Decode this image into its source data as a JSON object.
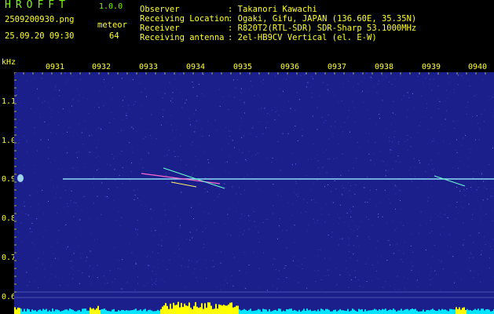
{
  "app": {
    "name": "HROFFT",
    "version": "1.0.0"
  },
  "file": {
    "name": "2509200930.png",
    "datetime": "25.09.20 09:30"
  },
  "detection": {
    "label": "meteor",
    "count": "64"
  },
  "info": {
    "observer_label": "Observer",
    "observer_value": ": Takanori Kawachi",
    "location_label": "Receiving Location",
    "location_value": ": Ogaki, Gifu, JAPAN (136.60E, 35.35N)",
    "receiver_label": "Receiver",
    "receiver_value": ": R820T2(RTL-SDR) SDR-Sharp 53.1000MHz",
    "antenna_label": "Receiving antenna",
    "antenna_value": ": 2el-HB9CV Vertical (el. E-W)"
  },
  "axis": {
    "unit": "kHz",
    "y_ticks": [
      "1.1",
      "1.0",
      "0.9",
      "0.8",
      "0.7",
      "0.6"
    ],
    "x_ticks": [
      "0931",
      "0932",
      "0933",
      "0934",
      "0935",
      "0936",
      "0937",
      "0938",
      "0939",
      "0940"
    ]
  },
  "colors": {
    "background": "#1a1f8c",
    "noise_light": "#3b46c8",
    "carrier": "#9ef0ff",
    "echo": "#ff66cc",
    "level_yellow": "#ffff00",
    "level_cyan": "#00e5ff"
  }
}
